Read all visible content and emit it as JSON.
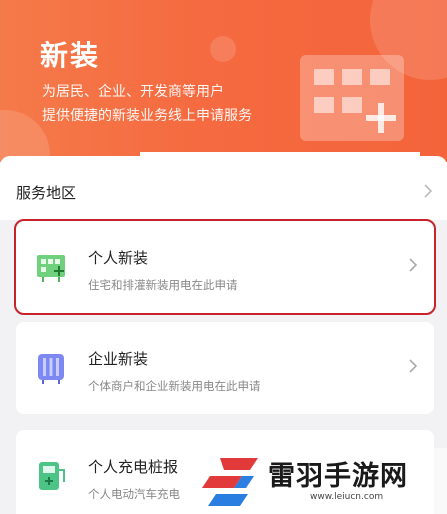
{
  "banner": {
    "title": "新装",
    "desc_line1": "为居民、企业、开发商等用户",
    "desc_line2": "提供便捷的新装业务线上申请服务"
  },
  "region": {
    "label": "服务地区"
  },
  "services": [
    {
      "title": "个人新装",
      "subtitle": "住宅和排灌新装用电在此申请",
      "icon": "green-meter-icon",
      "color": "#5cc46b"
    },
    {
      "title": "企业新装",
      "subtitle": "个体商户和企业新装用电在此申请",
      "icon": "purple-meter-icon",
      "color": "#6e7bf0"
    },
    {
      "title": "个人充电桩报",
      "subtitle": "个人电动汽车充电",
      "icon": "charging-pile-icon",
      "color": "#3fbf7a"
    }
  ],
  "watermark": {
    "text": "雷羽手游网",
    "url": "www.leiucn.com"
  },
  "colors": {
    "banner": "#f56a40",
    "highlight_border": "#c9222a"
  }
}
